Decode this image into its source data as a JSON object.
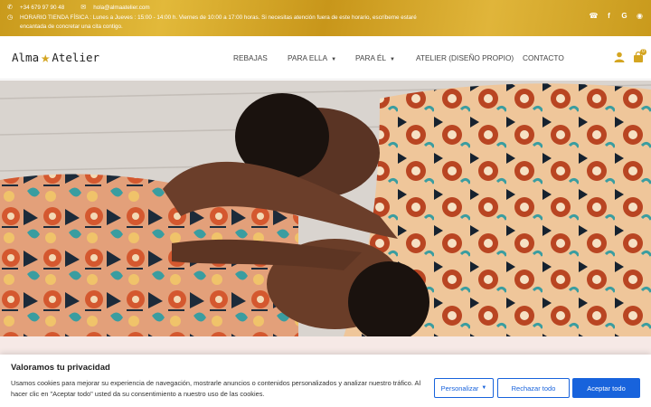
{
  "topbar": {
    "phone": "+34 679 97 90 48",
    "email": "hola@almaatelier.com",
    "hours": "HORARIO TIENDA FÍSICA : Lunes a Jueves : 15:00 - 14:00 h. Viernes de 10:00 a 17:00 horas. Si necesitas atención fuera de este horario, escríbeme estaré encantada de concretar una cita contigo.",
    "social": [
      "whatsapp-icon",
      "facebook-icon",
      "google-icon",
      "instagram-icon"
    ]
  },
  "header": {
    "logo_left": "Alma",
    "logo_right": "Atelier",
    "nav": [
      {
        "label": "REBAJAS",
        "dropdown": false
      },
      {
        "label": "PARA ELLA",
        "dropdown": true
      },
      {
        "label": "PARA ÉL",
        "dropdown": true
      },
      {
        "label": "ATELIER (DISEÑO PROPIO)",
        "dropdown": false
      },
      {
        "label": "CONTACTO",
        "dropdown": false
      }
    ],
    "cart_count": "0",
    "accent_color": "#d4a521"
  },
  "cookie": {
    "title": "Valoramos tu privacidad",
    "text": "Usamos cookies para mejorar su experiencia de navegación, mostrarle anuncios o contenidos personalizados y analizar nuestro tráfico. Al hacer clic en \"Aceptar todo\" usted da su consentimiento a nuestro uso de las cookies.",
    "customize_label": "Personalizar",
    "reject_label": "Rechazar todo",
    "accept_label": "Aceptar todo",
    "button_color": "#1863dc"
  }
}
